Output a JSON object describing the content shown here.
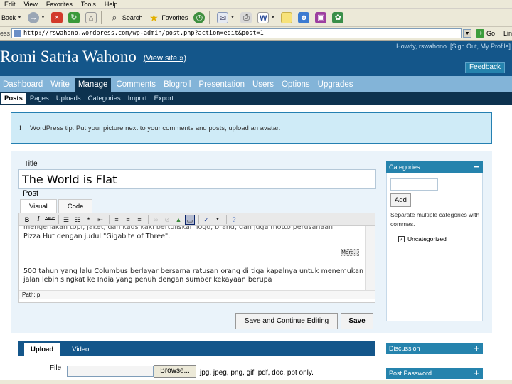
{
  "browser": {
    "menu": [
      "Edit",
      "View",
      "Favorites",
      "Tools",
      "Help"
    ],
    "toolbar": {
      "back": "Back",
      "search": "Search",
      "favorites": "Favorites"
    },
    "address_label": "ess",
    "address_url": "http://rswahono.wordpress.com/wp-admin/post.php?action=edit&post=1",
    "go": "Go",
    "links": "Lin"
  },
  "header": {
    "blog_title": "Romi Satria Wahono",
    "view_site": "(View site »)",
    "howdy": "Howdy, rswahono. [Sign Out, My Profile]",
    "feedback": "Feedback"
  },
  "main_nav": [
    "Dashboard",
    "Write",
    "Manage",
    "Comments",
    "Blogroll",
    "Presentation",
    "Users",
    "Options",
    "Upgrades"
  ],
  "sub_nav": [
    "Posts",
    "Pages",
    "Uploads",
    "Categories",
    "Import",
    "Export"
  ],
  "tip": {
    "mark": "!",
    "text": "WordPress tip: Put your picture next to your comments and posts, upload an avatar."
  },
  "post": {
    "title_label": "Title",
    "title_value": "The World is Flat",
    "post_label": "Post",
    "tab_visual": "Visual",
    "tab_code": "Code",
    "line1": "mengenakan topi, jaket, dan kaus kaki bertuliskan logo, brand, dan juga motto perusahaan",
    "line2": "Pizza Hut dengan judul \"Gigabite of Three\".",
    "more": "More...",
    "paragraph": "500 tahun yang lalu Columbus berlayar bersama ratusan orang di tiga kapalnya untuk menemukan jalan lebih singkat ke India yang penuh dengan sumber kekayaan berupa",
    "path": "Path: p"
  },
  "buttons": {
    "save_continue": "Save and Continue Editing",
    "save": "Save"
  },
  "sidebar": {
    "categories": "Categories",
    "add": "Add",
    "help": "Separate multiple categories with commas.",
    "uncategorized": "Uncategorized",
    "discussion": "Discussion",
    "post_password": "Post Password"
  },
  "upload": {
    "tab_upload": "Upload",
    "tab_video": "Video",
    "file_label": "File",
    "browse": "Browse...",
    "file_types": "jpg, jpeg, png, gif, pdf, doc, ppt only."
  }
}
